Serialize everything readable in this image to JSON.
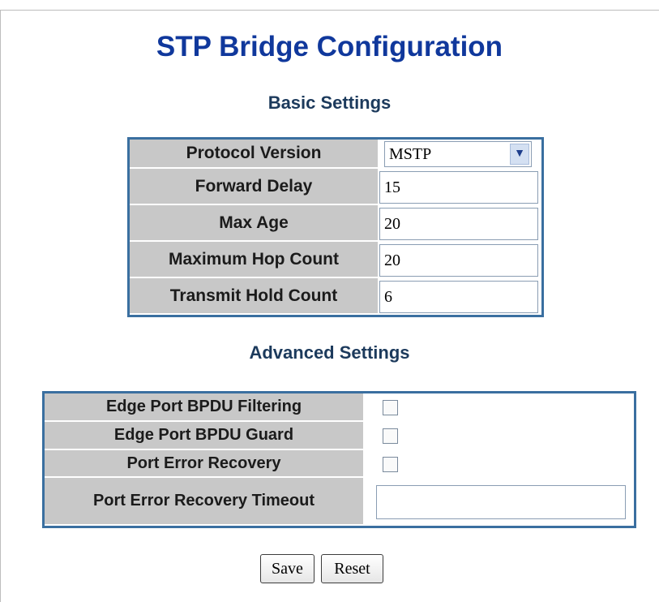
{
  "page_title": "STP Bridge Configuration",
  "basic": {
    "title": "Basic Settings",
    "protocol_version": {
      "label": "Protocol Version",
      "value": "MSTP",
      "arrow_icon": "chevron-down-icon"
    },
    "forward_delay": {
      "label": "Forward Delay",
      "value": "15"
    },
    "max_age": {
      "label": "Max Age",
      "value": "20"
    },
    "max_hop_count": {
      "label": "Maximum Hop Count",
      "value": "20"
    },
    "tx_hold_count": {
      "label": "Transmit Hold Count",
      "value": "6"
    }
  },
  "advanced": {
    "title": "Advanced Settings",
    "bpdu_filtering": {
      "label": "Edge Port BPDU Filtering",
      "checked": false
    },
    "bpdu_guard": {
      "label": "Edge Port BPDU Guard",
      "checked": false
    },
    "error_recovery": {
      "label": "Port Error Recovery",
      "checked": false
    },
    "error_recovery_timeout": {
      "label": "Port Error Recovery Timeout",
      "value": ""
    }
  },
  "buttons": {
    "save": "Save",
    "reset": "Reset"
  },
  "colors": {
    "title": "#10389c",
    "table_border": "#3a6fa0",
    "label_bg": "#c8c8c8"
  }
}
